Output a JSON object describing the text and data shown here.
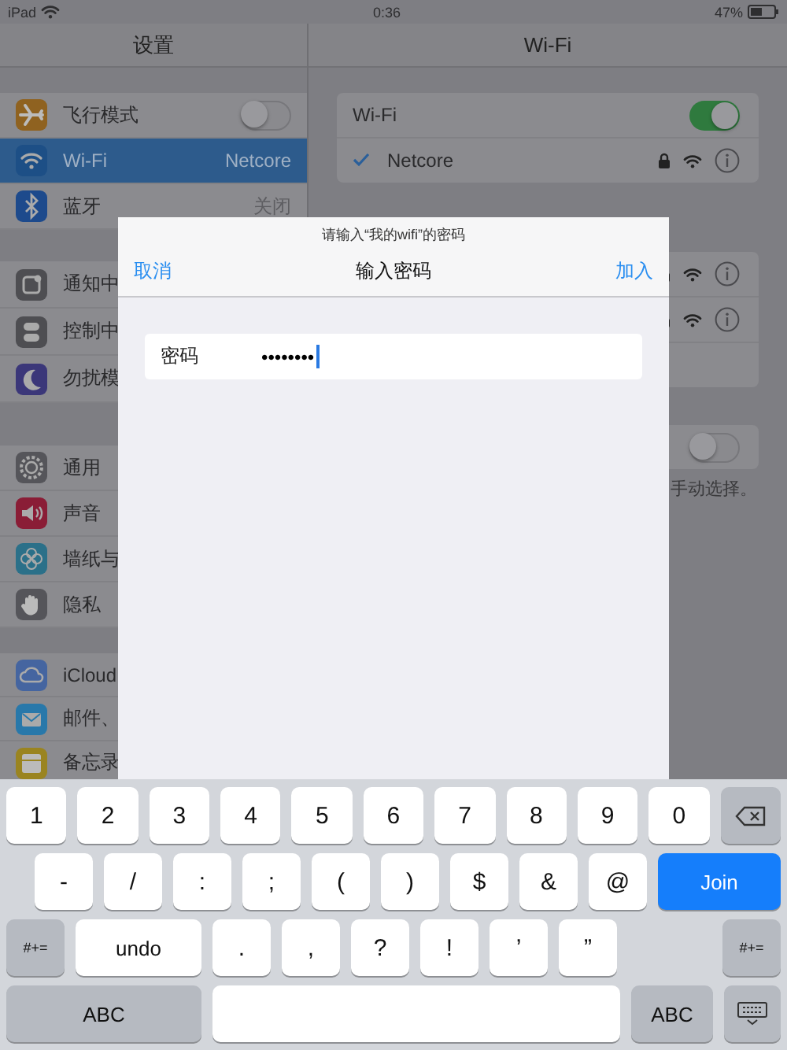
{
  "status_bar": {
    "device": "iPad",
    "time": "0:36",
    "battery": "47%"
  },
  "sidebar": {
    "title": "设置",
    "groups": [
      {
        "items": [
          {
            "label": "飞行模式",
            "color": "#8f6220",
            "selected": false,
            "toggle": {
              "on": false
            }
          },
          {
            "label": "Wi-Fi",
            "color": "#1d4f86",
            "selected": true,
            "value": "Netcore"
          },
          {
            "label": "蓝牙",
            "color": "#1d4a8c",
            "selected": false,
            "value": "关闭"
          }
        ]
      },
      {
        "items": [
          {
            "label": "通知中",
            "color": "#4e4e52",
            "selected": false
          },
          {
            "label": "控制中",
            "color": "#4e4e52",
            "selected": false
          },
          {
            "label": "勿扰模",
            "color": "#3b3779",
            "selected": false
          }
        ]
      },
      {
        "items": [
          {
            "label": "通用",
            "color": "#55555a",
            "selected": false
          },
          {
            "label": "声音",
            "color": "#8a1d36",
            "selected": false
          },
          {
            "label": "墙纸与",
            "color": "#2b7089",
            "selected": false
          },
          {
            "label": "隐私",
            "color": "#55555a",
            "selected": false
          }
        ]
      },
      {
        "items": [
          {
            "label": "iCloud",
            "color": "#4565a0",
            "selected": false
          },
          {
            "label": "邮件、",
            "color": "#2878aa",
            "selected": false
          },
          {
            "label": "备忘录",
            "color": "#9a8420",
            "selected": false
          }
        ]
      }
    ]
  },
  "wifi": {
    "title": "Wi-Fi",
    "wifi_row": {
      "label": "Wi-Fi",
      "on": true
    },
    "current": {
      "label": "Netcore",
      "connected": true,
      "secured": true
    },
    "networks": [
      {
        "secured": true
      },
      {
        "secured": true
      }
    ],
    "ask_to_join": {
      "on": false
    },
    "footnote": "手动选择。"
  },
  "dialog": {
    "prompt": "请输入“我的wifi”的密码",
    "title": "输入密码",
    "cancel": "取消",
    "join": "加入",
    "field": {
      "label": "密码",
      "value": "••••••••"
    }
  },
  "keyboard": {
    "rows": [
      [
        {
          "kind": "char",
          "label": "1"
        },
        {
          "kind": "char",
          "label": "2"
        },
        {
          "kind": "char",
          "label": "3"
        },
        {
          "kind": "char",
          "label": "4"
        },
        {
          "kind": "char",
          "label": "5"
        },
        {
          "kind": "char",
          "label": "6"
        },
        {
          "kind": "char",
          "label": "7"
        },
        {
          "kind": "char",
          "label": "8"
        },
        {
          "kind": "char",
          "label": "9"
        },
        {
          "kind": "char",
          "label": "0"
        },
        {
          "kind": "delete"
        }
      ],
      [
        {
          "kind": "char",
          "label": "-"
        },
        {
          "kind": "char",
          "label": "/"
        },
        {
          "kind": "char",
          "label": ":"
        },
        {
          "kind": "char",
          "label": ";"
        },
        {
          "kind": "char",
          "label": "("
        },
        {
          "kind": "char",
          "label": ")"
        },
        {
          "kind": "char",
          "label": "$"
        },
        {
          "kind": "char",
          "label": "&"
        },
        {
          "kind": "char",
          "label": "@"
        },
        {
          "kind": "join",
          "label": "Join"
        }
      ],
      [
        {
          "kind": "shift",
          "label": "#+="
        },
        {
          "kind": "wide",
          "label": "undo"
        },
        {
          "kind": "char",
          "label": "."
        },
        {
          "kind": "char",
          "label": ","
        },
        {
          "kind": "char",
          "label": "?"
        },
        {
          "kind": "char",
          "label": "!"
        },
        {
          "kind": "char",
          "label": "’"
        },
        {
          "kind": "char",
          "label": "”"
        },
        {
          "kind": "gap"
        },
        {
          "kind": "shift",
          "label": "#+="
        }
      ],
      [
        {
          "kind": "mode",
          "label": "ABC"
        },
        {
          "kind": "space"
        },
        {
          "kind": "mode2",
          "label": "ABC"
        },
        {
          "kind": "hide"
        }
      ]
    ]
  }
}
